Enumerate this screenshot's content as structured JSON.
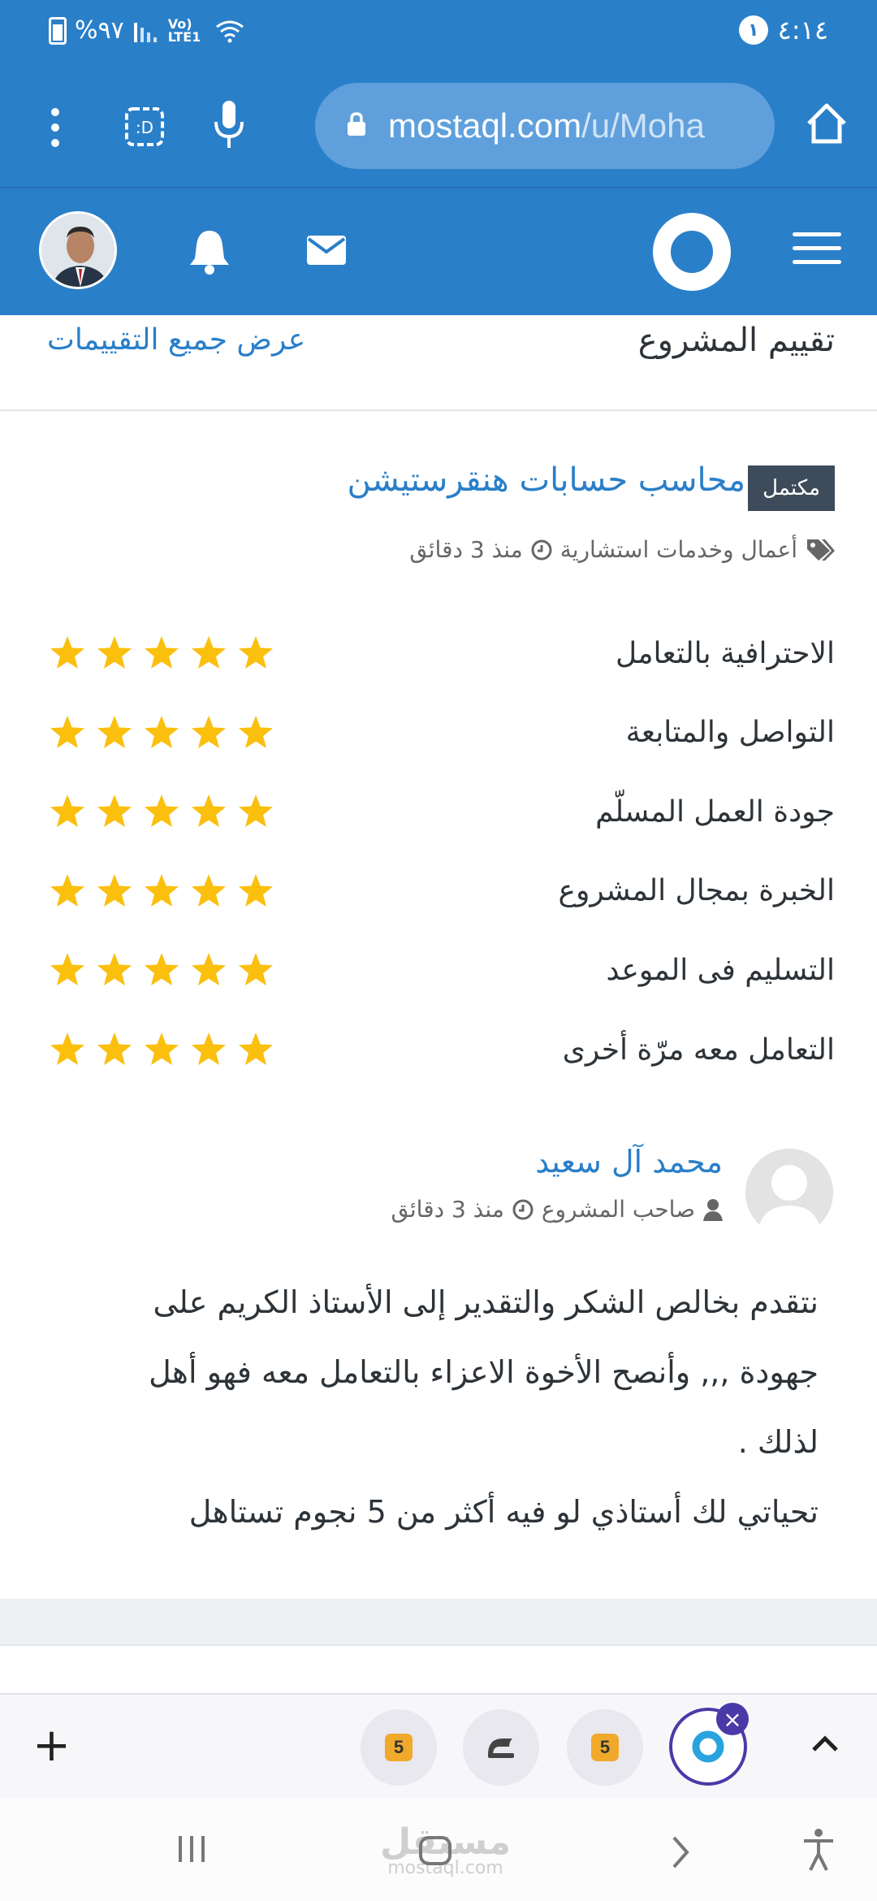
{
  "statusbar": {
    "battery": "%٩٧",
    "network": "Vo) LTE1",
    "notification_count": "١",
    "time": "٤:١٤"
  },
  "browser": {
    "url_main": "mostaql.com",
    "url_rest": "/u/Moha"
  },
  "header": {
    "brand_color": "#2a7fc9"
  },
  "section": {
    "title": "تقييم المشروع",
    "view_all": "عرض جميع التقييمات"
  },
  "project": {
    "status": "مكتمل",
    "title": "محاسب حسابات هنقرستيشن",
    "category": "أعمال وخدمات استشارية",
    "time": "منذ 3 دقائق"
  },
  "criteria": [
    {
      "label": "الاحترافية بالتعامل",
      "rating": 5
    },
    {
      "label": "التواصل والمتابعة",
      "rating": 5
    },
    {
      "label": "جودة العمل المسلّم",
      "rating": 5
    },
    {
      "label": "الخبرة بمجال المشروع",
      "rating": 5
    },
    {
      "label": "التسليم فى الموعد",
      "rating": 5
    },
    {
      "label": "التعامل معه مرّة أخرى",
      "rating": 5
    }
  ],
  "review": {
    "name": "محمد آل سعيد",
    "role": "صاحب المشروع",
    "time": "منذ 3 دقائق",
    "lines": [
      "نتقدم بخالص الشكر والتقدير إلى الأستاذ الكريم على",
      "جهودة ,,, وأنصح الأخوة الاعزاء بالتعامل معه فهو أهل",
      "لذلك .",
      "تحياتي لك أستاذي لو فيه أكثر من 5 نجوم تستاهل"
    ]
  },
  "tabs": {
    "tab_badge": "5",
    "add_label": "+"
  },
  "watermark": {
    "ar": "مستقل",
    "en": "mostaql.com"
  }
}
